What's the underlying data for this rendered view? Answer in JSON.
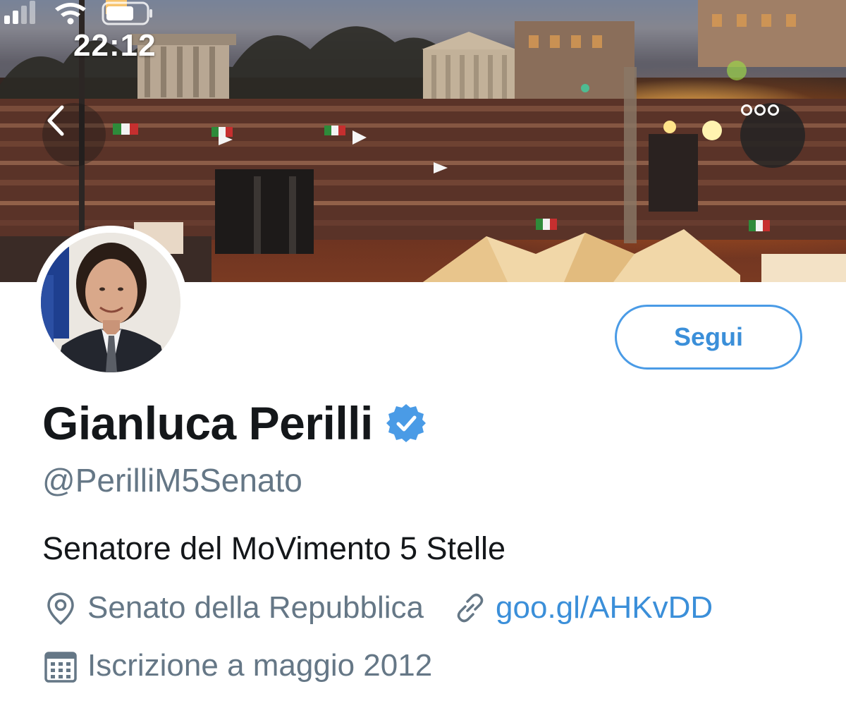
{
  "status_bar": {
    "time": "22:12"
  },
  "banner": {
    "back_icon": "chevron-left-icon",
    "more_icon": "ellipsis-icon"
  },
  "profile": {
    "display_name": "Gianluca Perilli",
    "verified_icon": "verified-badge-icon",
    "handle": "@PerilliM5Senato",
    "bio": "Senatore del MoVimento 5 Stelle",
    "location": "Senato della Repubblica",
    "website": "goo.gl/AHKvDD",
    "joined": "Iscrizione a maggio 2012"
  },
  "actions": {
    "follow_label": "Segui"
  },
  "colors": {
    "accent": "#3b8fd9",
    "verified": "#4a9be6",
    "secondary_text": "#657786",
    "primary_text": "#14171a"
  }
}
